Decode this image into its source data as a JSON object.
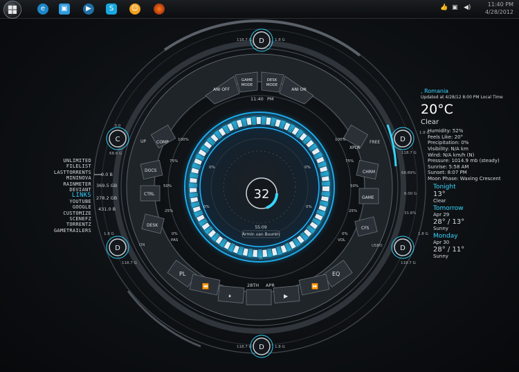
{
  "taskbar": {
    "start_icon": "windows-logo",
    "pinned": [
      "ie-icon",
      "explorer-icon",
      "media-player-icon",
      "skype-icon",
      "messenger-icon",
      "firefox-icon"
    ],
    "clock_time": "11:40 PM",
    "clock_date": "4/28/2012"
  },
  "hud": {
    "center_value": "32",
    "time": "55:09",
    "username": "Armin van Buuren",
    "clock_label": "11:40",
    "clock_ampm": "PM",
    "date_label": "28TH",
    "month_label": "APR",
    "top_buttons": [
      {
        "label": "ANI OFF"
      },
      {
        "label": "GAME\nMODE"
      },
      {
        "label": "DESK\nMODE"
      },
      {
        "label": "ANI ON"
      }
    ],
    "left_buttons": [
      "UP",
      "COMP",
      "DOCS",
      "CTRL",
      "DESK",
      "PL"
    ],
    "right_buttons": [
      "XPLR",
      "FREE",
      "CHRM",
      "GAME",
      "CFS",
      "EQ"
    ],
    "bottom_controls": [
      "⏪",
      "⏸",
      "",
      "▶",
      "⏩"
    ],
    "left_ticks": [
      "100%",
      "75%",
      "50%",
      "25%",
      "0%",
      "PAS"
    ],
    "right_ticks": [
      "100%",
      "75%",
      "50%",
      "25%",
      "0%",
      "VOL"
    ],
    "inner_left": [
      "0%",
      "0%"
    ],
    "inner_right": [
      "0%",
      "0%"
    ],
    "drive_c": "C",
    "drive_d": "D",
    "outer_labels": {
      "top_left": "118.7 G",
      "top_right": "1.8 G",
      "left_top": "0.0",
      "left_mid": "68.6 G",
      "left_lower": "1.8 G",
      "left_lower2": "118.7 G",
      "left_on": "ON",
      "right_top": "1.8 G",
      "right_mid": "68.89%",
      "right_mid2": "6.00 G",
      "right_mid3": "31.6%",
      "right_lower": "1.8 G",
      "right_lower2": "118.7 G",
      "right_usb": "USBO",
      "right_bottom": "118.7 G",
      "bottom_left": "118.7 G",
      "bottom_right": "1.8 G"
    }
  },
  "links": {
    "items": [
      "UNLIMITED",
      "FILELIST",
      "LASTTORRENTS",
      "MININOVA",
      "RAINMETER",
      "DEVIANT"
    ],
    "header": "LINKS",
    "items2": [
      "YOUTUBE",
      "GOOGLE",
      "CUSTOMIZE",
      "SCENEFZ",
      "TORRENTZ",
      "GAMETRAILERS"
    ]
  },
  "drives": {
    "c_used": "0.0 B",
    "c_free": "369.5 GB",
    "d_used": "278.2 GB",
    "d_free": "431.0 B"
  },
  "weather": {
    "location": ", Romania",
    "updated": "Updated at 4/28/12 8:00 PM Local Time",
    "temp": "20°C",
    "condition": "Clear",
    "details": [
      "Humidity: 52%",
      "Feels Like: 20°",
      "Precipitation: 0%",
      "Visibility: N/A km",
      "Wind: N/A km/h (N)",
      "Pressure: 1014.9 mb (steady)",
      "Sunrise: 5:58 AM",
      "Sunset: 8:07 PM",
      "Moon Phase: Waxing Crescent"
    ],
    "tonight": {
      "label": "Tonight",
      "temp": "13°",
      "cond": "Clear"
    },
    "tomorrow": {
      "label": "Tomorrow",
      "date": "Apr 29",
      "temp": "28° / 13°",
      "cond": "Sunny"
    },
    "monday": {
      "label": "Monday",
      "date": "Apr 30",
      "temp": "28° / 11°",
      "cond": "Sunny"
    }
  },
  "colors": {
    "accent": "#35d6ff",
    "glow": "#1fb8ff",
    "panel": "#2b3137"
  }
}
